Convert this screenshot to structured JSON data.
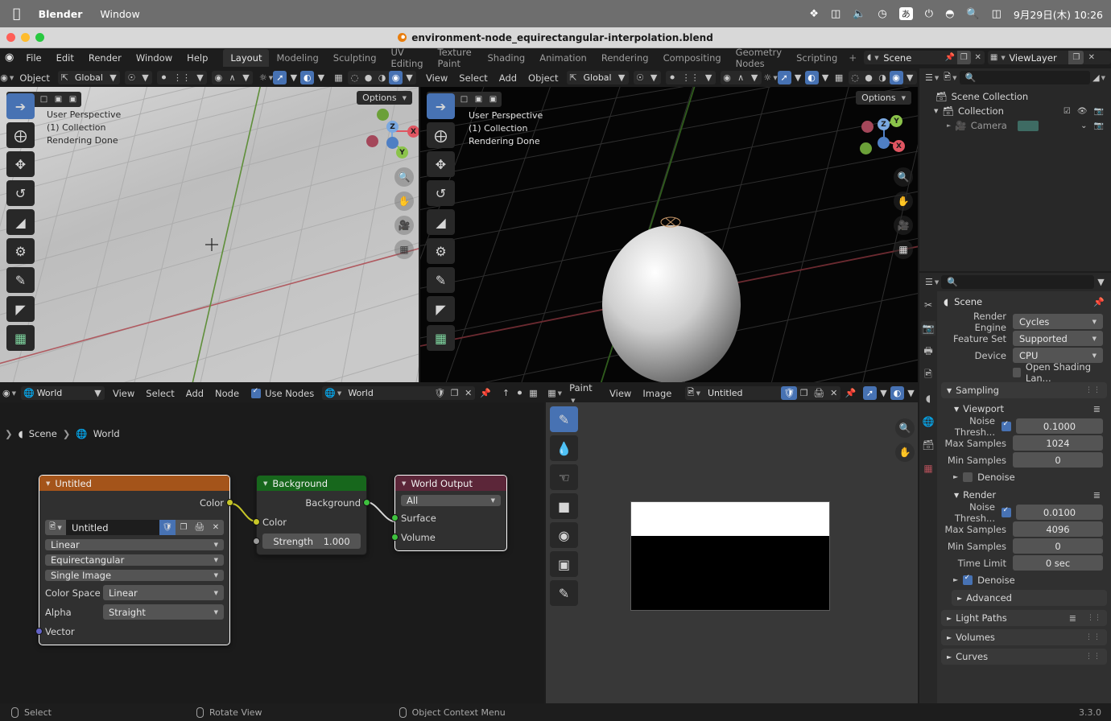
{
  "macbar": {
    "apple_icon": "apple-icon",
    "app_name": "Blender",
    "window_menu": "Window",
    "status_icons": [
      "dropbox-icon",
      "battery-meter-icon",
      "volume-icon",
      "timemachine-icon",
      "ime-icon",
      "battery-charging-icon",
      "wifi-icon",
      "search-icon",
      "display-icon"
    ],
    "ime_label": "あ",
    "clock": "9月29日(木)  10:26"
  },
  "window": {
    "title": "environment-node_equirectangular-interpolation.blend"
  },
  "topbar": {
    "menus": [
      "File",
      "Edit",
      "Render",
      "Window",
      "Help"
    ],
    "workspaces": [
      "Layout",
      "Modeling",
      "Sculpting",
      "UV Editing",
      "Texture Paint",
      "Shading",
      "Animation",
      "Rendering",
      "Compositing",
      "Geometry Nodes",
      "Scripting"
    ],
    "active_workspace": "Layout",
    "add_workspace": "+",
    "scene_name": "Scene",
    "viewlayer_name": "ViewLayer"
  },
  "viewport_left": {
    "header": {
      "mode": "Object",
      "transform_orientation": "Global",
      "snap_icon": "magnet-icon",
      "proportional_icon": "proportional-edit-icon"
    },
    "overlay": {
      "perspective": "User Perspective",
      "collection": "(1) Collection",
      "status": "Rendering Done"
    },
    "options_label": "Options",
    "gizmo_axes": [
      "X",
      "Y",
      "Z"
    ],
    "tools": [
      "select-box-tool",
      "cursor-tool",
      "move-tool",
      "rotate-tool",
      "scale-tool",
      "transform-tool",
      "annotate-tool",
      "measure-tool",
      "add-cube-tool"
    ]
  },
  "viewport_right": {
    "header": {
      "menus": [
        "View",
        "Select",
        "Add",
        "Object"
      ],
      "transform_orientation": "Global"
    },
    "overlay": {
      "perspective": "User Perspective",
      "collection": "(1) Collection",
      "status": "Rendering Done"
    },
    "options_label": "Options",
    "gizmo_axes": [
      "X",
      "Y",
      "Z"
    ]
  },
  "shader_editor": {
    "header": {
      "shader_type": "World",
      "menus": [
        "View",
        "Select",
        "Add",
        "Node"
      ],
      "use_nodes_label": "Use Nodes",
      "use_nodes_checked": true,
      "world_name": "World"
    },
    "breadcrumb": [
      "Scene",
      "World"
    ],
    "nodes": [
      {
        "title": "Untitled",
        "header_color": "#a4541a",
        "selected": true,
        "output_socket": "Color",
        "image_name": "Untitled",
        "interpolation": "Linear",
        "projection": "Equirectangular",
        "source": "Single Image",
        "color_space_label": "Color Space",
        "color_space": "Linear",
        "alpha_label": "Alpha",
        "alpha": "Straight",
        "input_socket": "Vector"
      },
      {
        "title": "Background",
        "header_color": "#17671c",
        "selected": false,
        "output_socket": "Background",
        "color_label": "Color",
        "strength_label": "Strength",
        "strength_value": "1.000"
      },
      {
        "title": "World Output",
        "header_color": "#5c2639",
        "selected": true,
        "target": "All",
        "inputs": [
          "Surface",
          "Volume"
        ]
      }
    ]
  },
  "image_editor": {
    "header": {
      "mode": "Paint",
      "menus": [
        "View",
        "Image"
      ],
      "image_name": "Untitled"
    },
    "tools": [
      "draw-brush-tool",
      "soften-tool",
      "smear-tool",
      "clone-tool",
      "fill-tool",
      "mask-tool",
      "annotate-tool"
    ],
    "image": {
      "top_color": "#ffffff",
      "bottom_color": "#000000"
    }
  },
  "outliner": {
    "search_placeholder": "",
    "rows": [
      {
        "label": "Scene Collection",
        "icon": "collection-icon",
        "indent": 0
      },
      {
        "label": "Collection",
        "icon": "collection-icon",
        "indent": 1
      },
      {
        "label": "Camera",
        "icon": "camera-icon",
        "indent": 2
      }
    ]
  },
  "properties": {
    "search_placeholder": "",
    "context_title": "Scene",
    "tabs": [
      "tool-icon",
      "render-icon",
      "output-icon",
      "viewlayer-icon",
      "scene-icon",
      "world-icon",
      "collection-icon",
      "texture-icon"
    ],
    "active_tab_index": 1,
    "fields": [
      {
        "label": "Render Engine",
        "value": "Cycles"
      },
      {
        "label": "Feature Set",
        "value": "Supported"
      },
      {
        "label": "Device",
        "value": "CPU"
      }
    ],
    "osl_label": "Open Shading Lan...",
    "osl_checked": false,
    "sampling_label": "Sampling",
    "viewport_label": "Viewport",
    "viewport": {
      "noise_label": "Noise Thresh...",
      "noise_checked": true,
      "noise_value": "0.1000",
      "max_samples_label": "Max Samples",
      "max_samples": "1024",
      "min_samples_label": "Min Samples",
      "min_samples": "0",
      "denoise_label": "Denoise",
      "denoise_checked": false
    },
    "render_label": "Render",
    "render": {
      "noise_label": "Noise Thresh...",
      "noise_checked": true,
      "noise_value": "0.0100",
      "max_samples_label": "Max Samples",
      "max_samples": "4096",
      "min_samples_label": "Min Samples",
      "min_samples": "0",
      "time_limit_label": "Time Limit",
      "time_limit": "0 sec",
      "denoise_label": "Denoise",
      "denoise_checked": true,
      "advanced_label": "Advanced"
    },
    "closed_panels": [
      "Light Paths",
      "Volumes",
      "Curves"
    ]
  },
  "statusbar": {
    "items": [
      {
        "icon": "mouse-left-icon",
        "label": "Select"
      },
      {
        "icon": "mouse-middle-icon",
        "label": "Rotate View"
      },
      {
        "icon": "mouse-right-icon",
        "label": "Object Context Menu"
      }
    ],
    "version": "3.3.0"
  },
  "colors": {
    "accent_blue": "#4772b3",
    "node_image_header": "#a4541a",
    "node_background_header": "#17671c",
    "node_output_header": "#5c2639"
  }
}
